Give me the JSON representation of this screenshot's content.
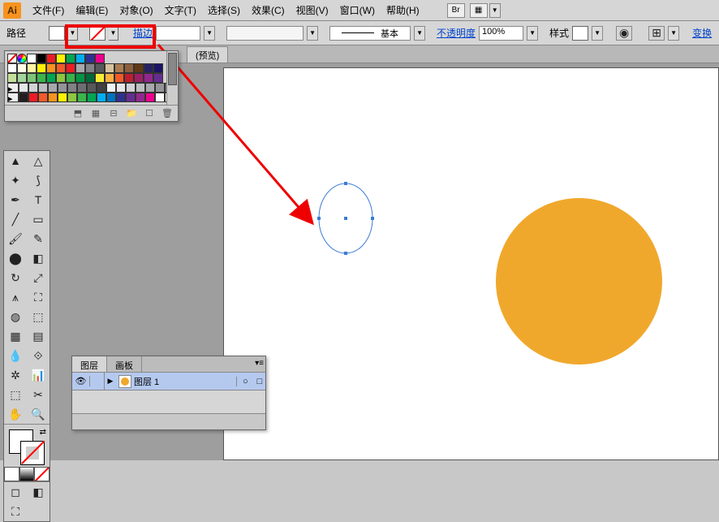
{
  "app": {
    "logo": "Ai"
  },
  "menu": {
    "file": "文件(F)",
    "edit": "编辑(E)",
    "object": "对象(O)",
    "type": "文字(T)",
    "select": "选择(S)",
    "effect": "效果(C)",
    "view": "视图(V)",
    "window": "窗口(W)",
    "help": "帮助(H)",
    "br": "Br"
  },
  "control": {
    "path_label": "路径",
    "stroke_link": "描边",
    "style_label": "基本",
    "opacity_link": "不透明度",
    "opacity_value": "100%",
    "style_link": "样式",
    "transform_link": "变换"
  },
  "tabs": {
    "preview": "(预览)"
  },
  "layers": {
    "tab_layers": "图层",
    "tab_artboards": "画板",
    "layer1_name": "图层 1",
    "eye": "👁"
  },
  "swatches": {
    "row1": [
      "#ffffff",
      "#000000",
      "#ed1c24",
      "#fff200",
      "#00a651",
      "#00aeef",
      "#2e3192",
      "#ec008c"
    ],
    "row2": [
      "#ffffff",
      "#fffde7",
      "#fef5a6",
      "#fff200",
      "#f7941d",
      "#f15a29",
      "#ed1c24",
      "#a7a9ac",
      "#808285",
      "#58595b",
      "#d7c29e",
      "#a97c50",
      "#8b5e3c",
      "#603913",
      "#262262",
      "#1b1464"
    ],
    "row3": [
      "#c4df9b",
      "#a3d39c",
      "#7cc576",
      "#39b54a",
      "#00a651",
      "#8dc63f",
      "#37b34a",
      "#009444",
      "#006838",
      "#f9ed32",
      "#fbb040",
      "#f15a29",
      "#be1e2d",
      "#9e1f63",
      "#92278f",
      "#662d91"
    ],
    "row4": [
      "#e6e7e8",
      "#d1d3d4",
      "#bcbec0",
      "#a7a9ac",
      "#939598",
      "#808285",
      "#6d6e71",
      "#58595b",
      "#414042",
      "#f1f2f2",
      "#e6e7e8",
      "#d1d3d4",
      "#bcbec0",
      "#a7a9ac",
      "#939598",
      "#808285"
    ],
    "row5": [
      "#231f20",
      "#ed1c24",
      "#f15a29",
      "#f7941d",
      "#fff200",
      "#8dc63f",
      "#39b54a",
      "#00a651",
      "#00aeef",
      "#0072bc",
      "#2e3192",
      "#662d91",
      "#92278f",
      "#ec008c",
      "#ffffff",
      "#fffde7"
    ]
  },
  "icons": {
    "gear": "⚙",
    "arrow_down": "▼",
    "play": "▶",
    "circle_sel": "○",
    "square_sel": "□",
    "trash": "🗑",
    "new": "☐",
    "folder": "📁",
    "link": "⧉"
  }
}
